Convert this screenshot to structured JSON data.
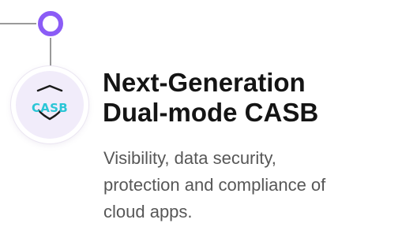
{
  "feature": {
    "title_lines": [
      "Next-Generation",
      "Dual-mode CASB"
    ],
    "description_lines": [
      "Visibility, data security,",
      "protection and compliance of",
      "cloud apps."
    ],
    "badge_text": "CASB",
    "icon": "shield-icon"
  },
  "colors": {
    "connector_node": "#8b5cf6",
    "connector_line": "#9a9a9a",
    "badge_background": "#f1ecfa",
    "badge_text": "#2bc6d6",
    "title": "#141414",
    "description": "#575757"
  }
}
